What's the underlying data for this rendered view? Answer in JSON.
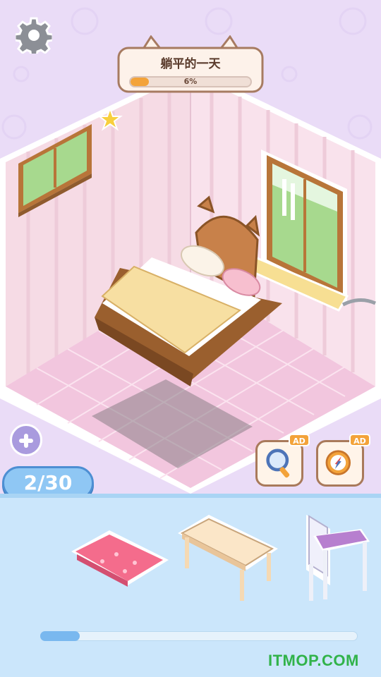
{
  "header": {
    "title": "躺平的一天",
    "progress_text": "6%",
    "progress_value": 0.06
  },
  "tools": {
    "ad_label": "AD"
  },
  "counter": {
    "text": "2/30"
  },
  "watermark": "ITMOP.COM",
  "inventory": {
    "items": [
      "pink-rug",
      "wooden-table",
      "purple-chair"
    ]
  },
  "colors": {
    "wall": "#f6dbe5",
    "floor": "#f2c6de",
    "tray": "#cbe6fb",
    "accent": "#f3a33a",
    "counter": "#8fc7f4"
  },
  "icons": {
    "settings": "gear-icon",
    "search": "magnifier-icon",
    "compass": "compass-icon",
    "add": "plus-icon",
    "star": "star-icon"
  }
}
